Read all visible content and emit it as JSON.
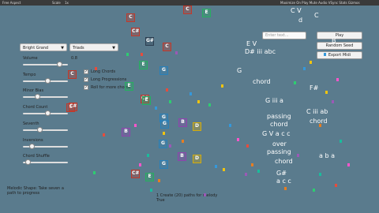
{
  "topbar": {
    "left": "Free Aspect",
    "scale": "Scale",
    "scale_value": "1x",
    "right": "Maximize On Play  Mute Audio  VSync  Stats  Gizmos"
  },
  "controls": {
    "instrument": "Bright Grand",
    "chord_type": "Triads",
    "sliders": [
      {
        "label": "Volume",
        "value": "0.8",
        "fill": 0.85
      },
      {
        "label": "Tempo",
        "value": "",
        "fill": 0.55
      },
      {
        "label": "Minor Bias",
        "value": "",
        "fill": 0.3
      },
      {
        "label": "Chord Count",
        "value": "",
        "fill": 0.55
      },
      {
        "label": "Seventh",
        "value": "",
        "fill": 0.35
      },
      {
        "label": "Inversions",
        "value": "",
        "fill": 0.15
      },
      {
        "label": "Chord Shuffle",
        "value": "",
        "fill": 0.05
      }
    ],
    "checkboxes": [
      {
        "label": "Long Chords",
        "checked": true
      },
      {
        "label": "Long Progressions",
        "checked": true
      },
      {
        "label": "Roll for more chords",
        "checked": true
      }
    ]
  },
  "right_panel": {
    "search_placeholder": "Enter text...",
    "play": "Play",
    "random_seed": "Random Seed",
    "export_midi": "Export Midi"
  },
  "status": {
    "left_line1": "Melodic Shape: Take seven a",
    "left_line2": "path to progress",
    "center_line1": "1 Create (20) paths for melody",
    "center_line2": "True"
  },
  "nodes": [
    {
      "t": "C",
      "c": "#c0392b"
    },
    {
      "t": "C",
      "c": "#c0392b"
    },
    {
      "t": "E",
      "c": "#27ae60"
    },
    {
      "t": "C#",
      "c": "#c0392b"
    },
    {
      "t": "E",
      "c": "#27ae60"
    },
    {
      "t": "G#",
      "c": "#2c3e50"
    },
    {
      "t": "C",
      "c": "#c0392b"
    },
    {
      "t": "E",
      "c": "#27ae60"
    },
    {
      "t": "C#",
      "c": "#c0392b"
    },
    {
      "t": "G",
      "c": "#2980b9"
    },
    {
      "t": "G",
      "c": "#2980b9"
    },
    {
      "t": "C",
      "c": "#c0392b"
    },
    {
      "t": "C",
      "c": "#c0392b"
    },
    {
      "t": "E",
      "c": "#27ae60"
    },
    {
      "t": "C#",
      "c": "#c0392b"
    },
    {
      "t": "G",
      "c": "#2980b9"
    },
    {
      "t": "B",
      "c": "#8e44ad"
    },
    {
      "t": "D",
      "c": "#d4ac0d"
    },
    {
      "t": "B",
      "c": "#8e44ad"
    },
    {
      "t": "G",
      "c": "#2980b9"
    },
    {
      "t": "B",
      "c": "#8e44ad"
    },
    {
      "t": "D",
      "c": "#d4ac0d"
    },
    {
      "t": "G",
      "c": "#2980b9"
    },
    {
      "t": "C#",
      "c": "#c0392b"
    },
    {
      "t": "E",
      "c": "#27ae60"
    }
  ],
  "cloud_text": [
    "C V",
    "d",
    "E V",
    "D# iii abc",
    "chord",
    "G iii a",
    "passing",
    "chord",
    "G V a c c",
    "over",
    "passing",
    "chord",
    "G#",
    "a c c",
    "C",
    "B",
    "G",
    "F#",
    "C iii ab",
    "chord",
    "a b a"
  ]
}
